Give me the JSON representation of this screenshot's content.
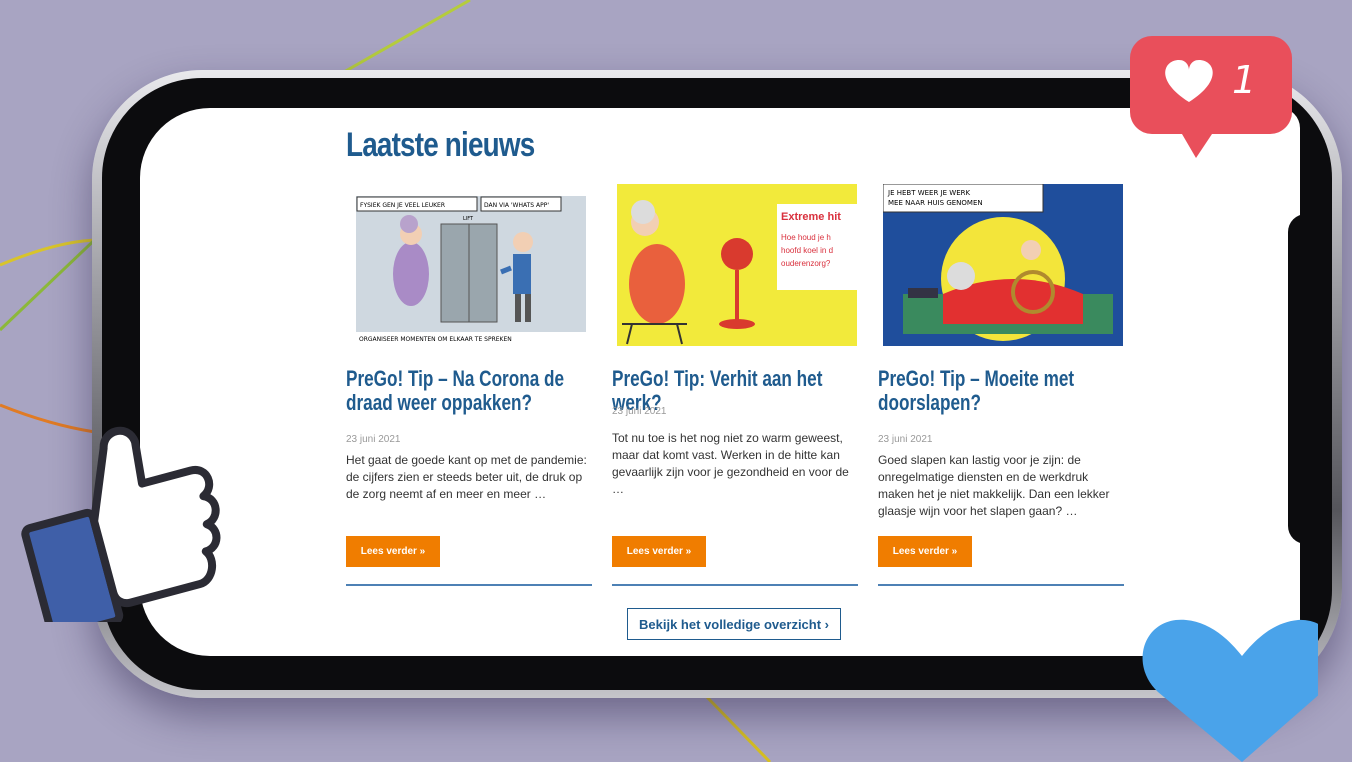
{
  "section_title": "Laatste nieuws",
  "articles": [
    {
      "title": "PreGo! Tip – Na Corona de draad weer oppakken?",
      "date": "23 juni 2021",
      "excerpt": "Het gaat de goede kant op met de pandemie: de cijfers zien er steeds beter uit, de druk op de zorg neemt af en meer en meer …",
      "button": "Lees verder »",
      "cartoon_text": [
        "FYSIEK GEN JE VEEL LEUKER",
        "DAN VIA 'WHATS APP'",
        "LIFT",
        "ORGANISEER MOMENTEN OM ELKAAR TE SPREKEN"
      ]
    },
    {
      "title": "PreGo! Tip: Verhit aan het werk?",
      "date": "23 juni 2021",
      "excerpt": "Tot nu toe is het nog niet zo warm geweest, maar dat komt vast. Werken in de hitte kan gevaarlijk zijn voor je gezondheid en voor de …",
      "button": "Lees verder »",
      "cartoon_text": [
        "Extreme hit",
        "Hoe houd je h",
        "hoofd koel in d",
        "ouderenzorg?"
      ]
    },
    {
      "title": "PreGo! Tip – Moeite met doorslapen?",
      "date": "23 juni 2021",
      "excerpt": "Goed slapen kan lastig voor je zijn: de onregelmatige diensten en de werkdruk maken het je niet makkelijk. Dan een lekker glaasje wijn voor het slapen gaan? …",
      "button": "Lees verder »",
      "cartoon_text": [
        "JE HEBT WEER JE WERK",
        "MEE NAAR HUIS GENOMEN"
      ]
    }
  ],
  "overview_button": "Bekijk het volledige overzicht ›",
  "like_count": "1",
  "colors": {
    "brand_blue": "#1f5b8e",
    "button_orange": "#f07d00",
    "background": "#a8a4c2",
    "like_red": "#e94f5b",
    "heart_blue": "#4aa3ea"
  },
  "icons": [
    "heart-icon",
    "thumbs-up-icon",
    "like-badge-icon"
  ]
}
